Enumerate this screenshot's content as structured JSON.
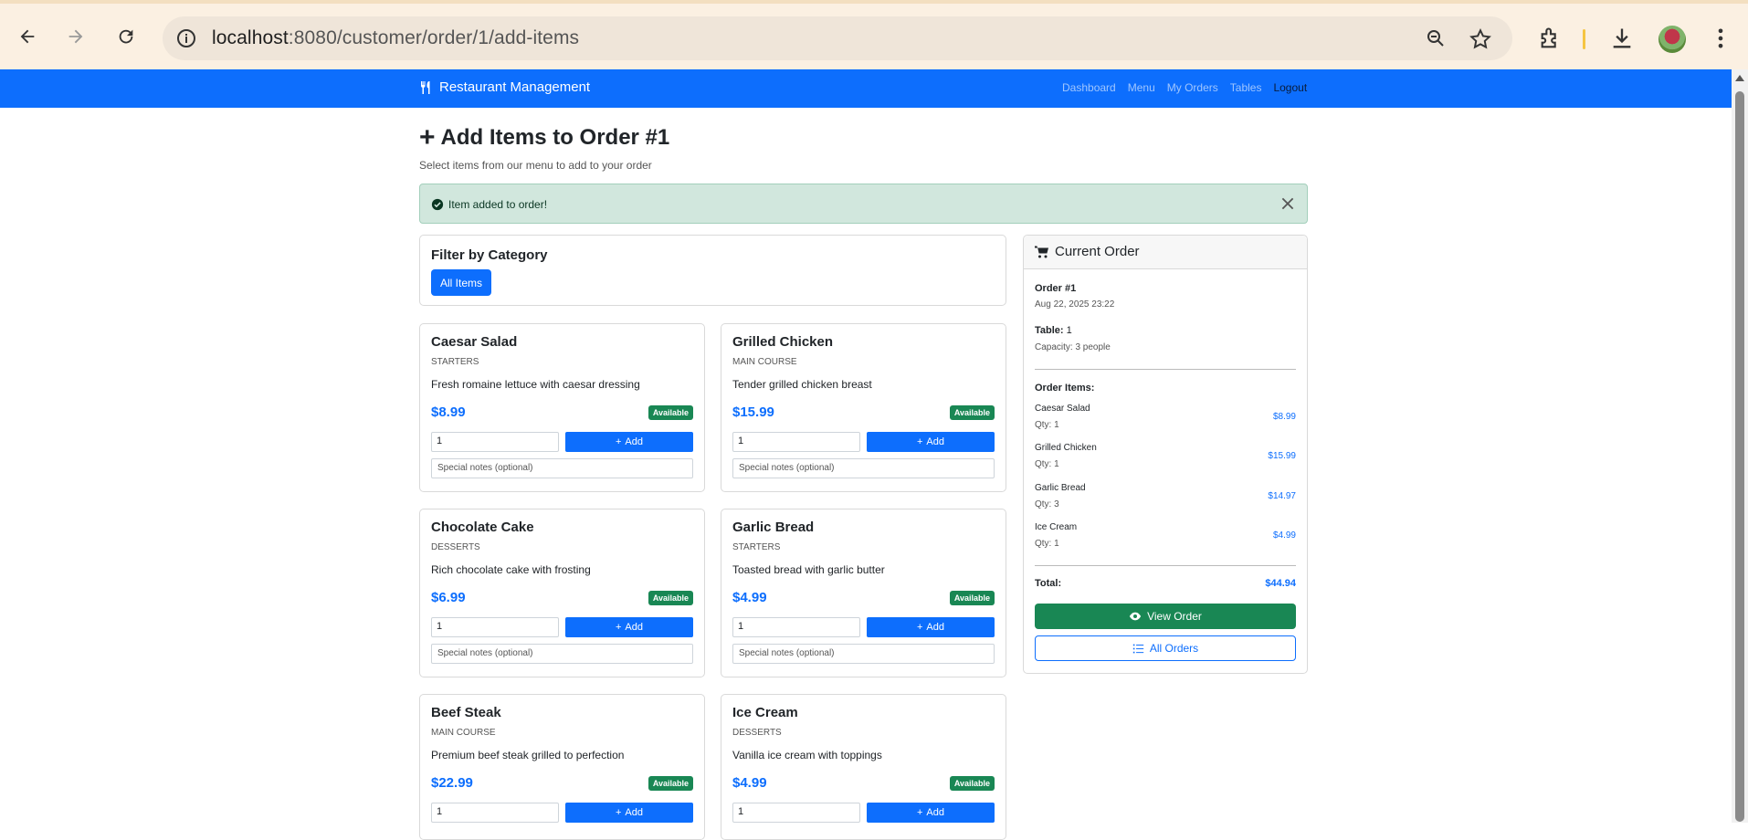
{
  "browser": {
    "url_host": "localhost",
    "url_path": ":8080/customer/order/1/add-items"
  },
  "navbar": {
    "brand": "Restaurant Management",
    "links": [
      "Dashboard",
      "Menu",
      "My Orders",
      "Tables",
      "Logout"
    ]
  },
  "page": {
    "title": "Add Items to Order #1",
    "subtitle": "Select items from our menu to add to your order"
  },
  "alert": {
    "message": "Item added to order!"
  },
  "filter": {
    "heading": "Filter by Category",
    "button": "All Items"
  },
  "items": [
    {
      "name": "Caesar Salad",
      "category": "STARTERS",
      "description": "Fresh romaine lettuce with caesar dressing",
      "price": "$8.99",
      "status": "Available",
      "qty": "1",
      "add_label": "Add",
      "notes_placeholder": "Special notes (optional)"
    },
    {
      "name": "Grilled Chicken",
      "category": "MAIN COURSE",
      "description": "Tender grilled chicken breast",
      "price": "$15.99",
      "status": "Available",
      "qty": "1",
      "add_label": "Add",
      "notes_placeholder": "Special notes (optional)"
    },
    {
      "name": "Chocolate Cake",
      "category": "DESSERTS",
      "description": "Rich chocolate cake with frosting",
      "price": "$6.99",
      "status": "Available",
      "qty": "1",
      "add_label": "Add",
      "notes_placeholder": "Special notes (optional)"
    },
    {
      "name": "Garlic Bread",
      "category": "STARTERS",
      "description": "Toasted bread with garlic butter",
      "price": "$4.99",
      "status": "Available",
      "qty": "1",
      "add_label": "Add",
      "notes_placeholder": "Special notes (optional)"
    },
    {
      "name": "Beef Steak",
      "category": "MAIN COURSE",
      "description": "Premium beef steak grilled to perfection",
      "price": "$22.99",
      "status": "Available",
      "qty": "1",
      "add_label": "Add",
      "notes_placeholder": ""
    },
    {
      "name": "Ice Cream",
      "category": "DESSERTS",
      "description": "Vanilla ice cream with toppings",
      "price": "$4.99",
      "status": "Available",
      "qty": "1",
      "add_label": "Add",
      "notes_placeholder": ""
    }
  ],
  "order": {
    "header": "Current Order",
    "number": "Order #1",
    "datetime": "Aug 22, 2025 23:22",
    "table_label": "Table:",
    "table_value": "1",
    "capacity": "Capacity: 3 people",
    "items_heading": "Order Items:",
    "items": [
      {
        "name": "Caesar Salad",
        "qty": "Qty: 1",
        "price": "$8.99"
      },
      {
        "name": "Grilled Chicken",
        "qty": "Qty: 1",
        "price": "$15.99"
      },
      {
        "name": "Garlic Bread",
        "qty": "Qty: 3",
        "price": "$14.97"
      },
      {
        "name": "Ice Cream",
        "qty": "Qty: 1",
        "price": "$4.99"
      }
    ],
    "total_label": "Total:",
    "total_value": "$44.94",
    "view_button": "View Order",
    "all_button": "All Orders"
  },
  "colors": {
    "primary": "#0d6efd",
    "success": "#198754",
    "alert_bg": "#d1e7dd"
  }
}
